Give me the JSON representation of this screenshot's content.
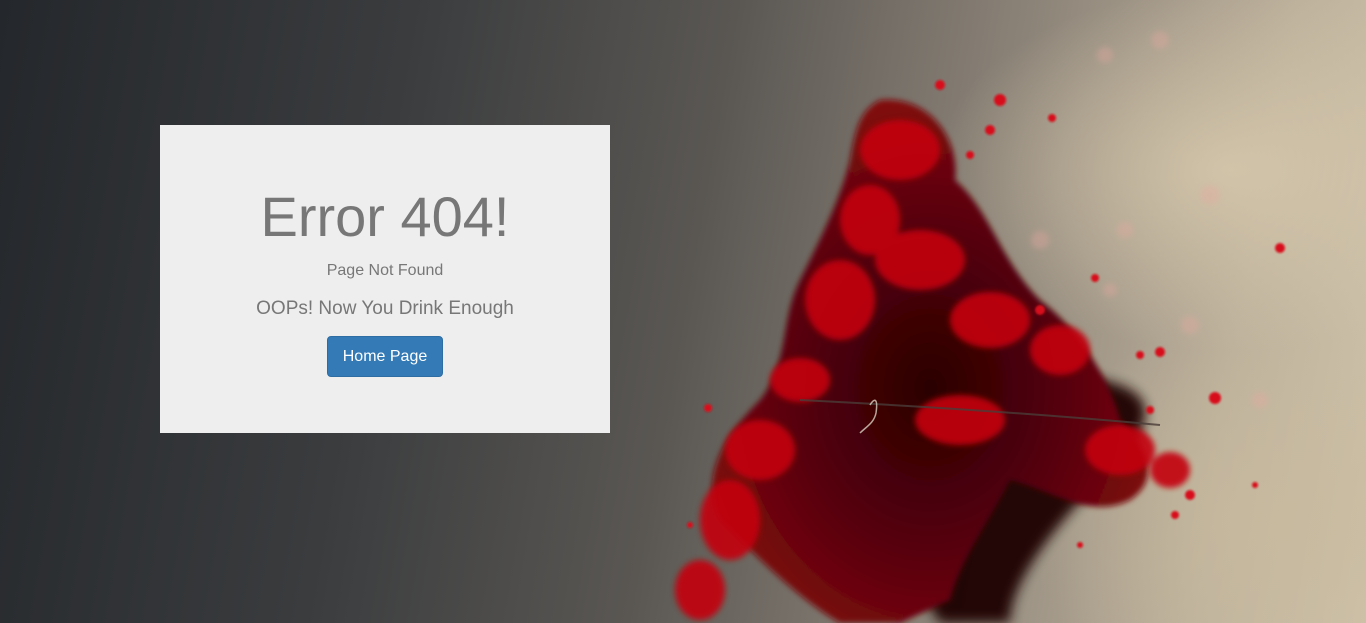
{
  "error": {
    "title": "Error 404!",
    "subtitle": "Page Not Found",
    "message": "OOPs! Now You Drink Enough",
    "home_button_label": "Home Page"
  },
  "colors": {
    "card_background": "#eeeeee",
    "text": "#777777",
    "button": "#337ab7",
    "button_text": "#ffffff",
    "splash": "#c4000a"
  }
}
